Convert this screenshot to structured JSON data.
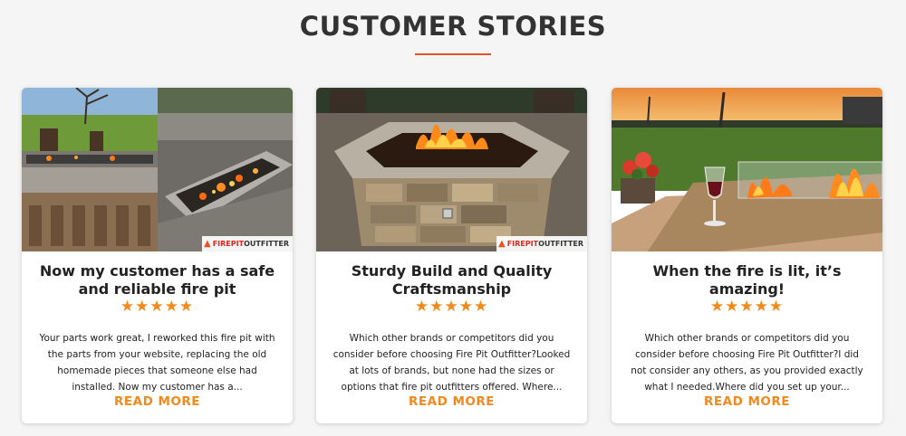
{
  "section": {
    "title": "CUSTOMER STORIES"
  },
  "brand": {
    "part1": "FIREPIT",
    "part2": "OUTFITTER",
    "accent": "#f08a1c",
    "underline": "#e8522a"
  },
  "cards": [
    {
      "title": "Now my customer has a safe and reliable fire pit",
      "stars": "★★★★★",
      "text": "Your parts work great, I reworked this fire pit with the parts from your website, replacing the old homemade pieces that someone else had installed. Now my customer has a...",
      "read_more": "READ MORE"
    },
    {
      "title": "Sturdy Build and Quality Craftsmanship",
      "stars": "★★★★★",
      "text": "Which other brands or competitors did you consider before choosing Fire Pit Outfitter?Looked at lots of brands, but none had the sizes or options that fire pit outfitters offered. Where...",
      "read_more": "READ MORE"
    },
    {
      "title": "When the fire is lit, it’s amazing!",
      "stars": "★★★★★",
      "text": "Which other brands or competitors did you consider before choosing Fire Pit Outfitter?I did not consider any others, as you provided exactly what I needed.Where did you set up your...",
      "read_more": "READ MORE"
    }
  ]
}
